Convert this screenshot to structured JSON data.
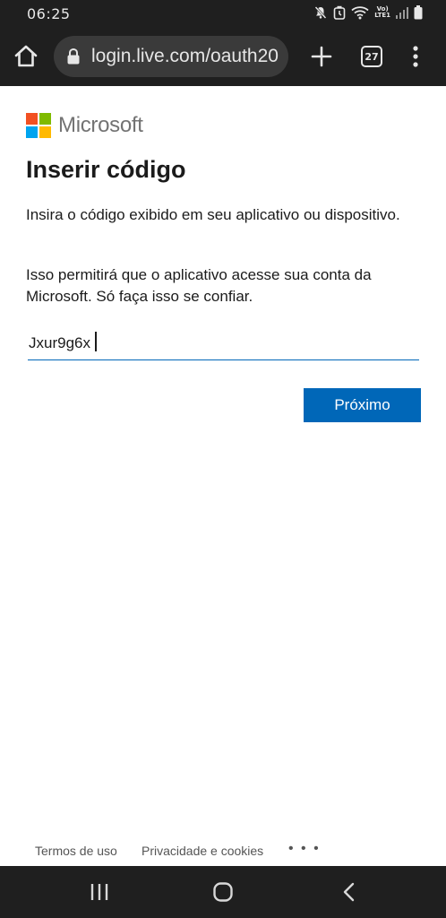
{
  "status_bar": {
    "time": "06:25",
    "network_label_top": "Vo)",
    "network_label_bottom": "LTE1",
    "icons": [
      "mute-icon",
      "alarm-icon",
      "wifi-icon",
      "signal-icon",
      "battery-icon"
    ]
  },
  "browser": {
    "url": "login.live.com/oauth20",
    "tab_count": "27",
    "icons": [
      "home-icon",
      "lock-icon",
      "plus-icon",
      "tabs-icon",
      "more-vertical-icon"
    ]
  },
  "page": {
    "brand": "Microsoft",
    "title": "Inserir código",
    "paragraph_1": "Insira o código exibido em seu aplicativo ou dispositivo.",
    "paragraph_2": "Isso permitirá que o aplicativo acesse sua conta da Microsoft. Só faça isso se confiar.",
    "code_input_value": "Jxur9g6x",
    "next_button": "Próximo",
    "colors": {
      "accent": "#0067b8",
      "logo_red": "#f25022",
      "logo_green": "#7fba00",
      "logo_blue": "#00a4ef",
      "logo_yellow": "#ffb900"
    }
  },
  "footer": {
    "terms": "Termos de uso",
    "privacy": "Privacidade e cookies",
    "more": "• • •"
  },
  "nav_bar": {
    "icons": [
      "recents-icon",
      "home-circle-icon",
      "back-icon"
    ]
  }
}
